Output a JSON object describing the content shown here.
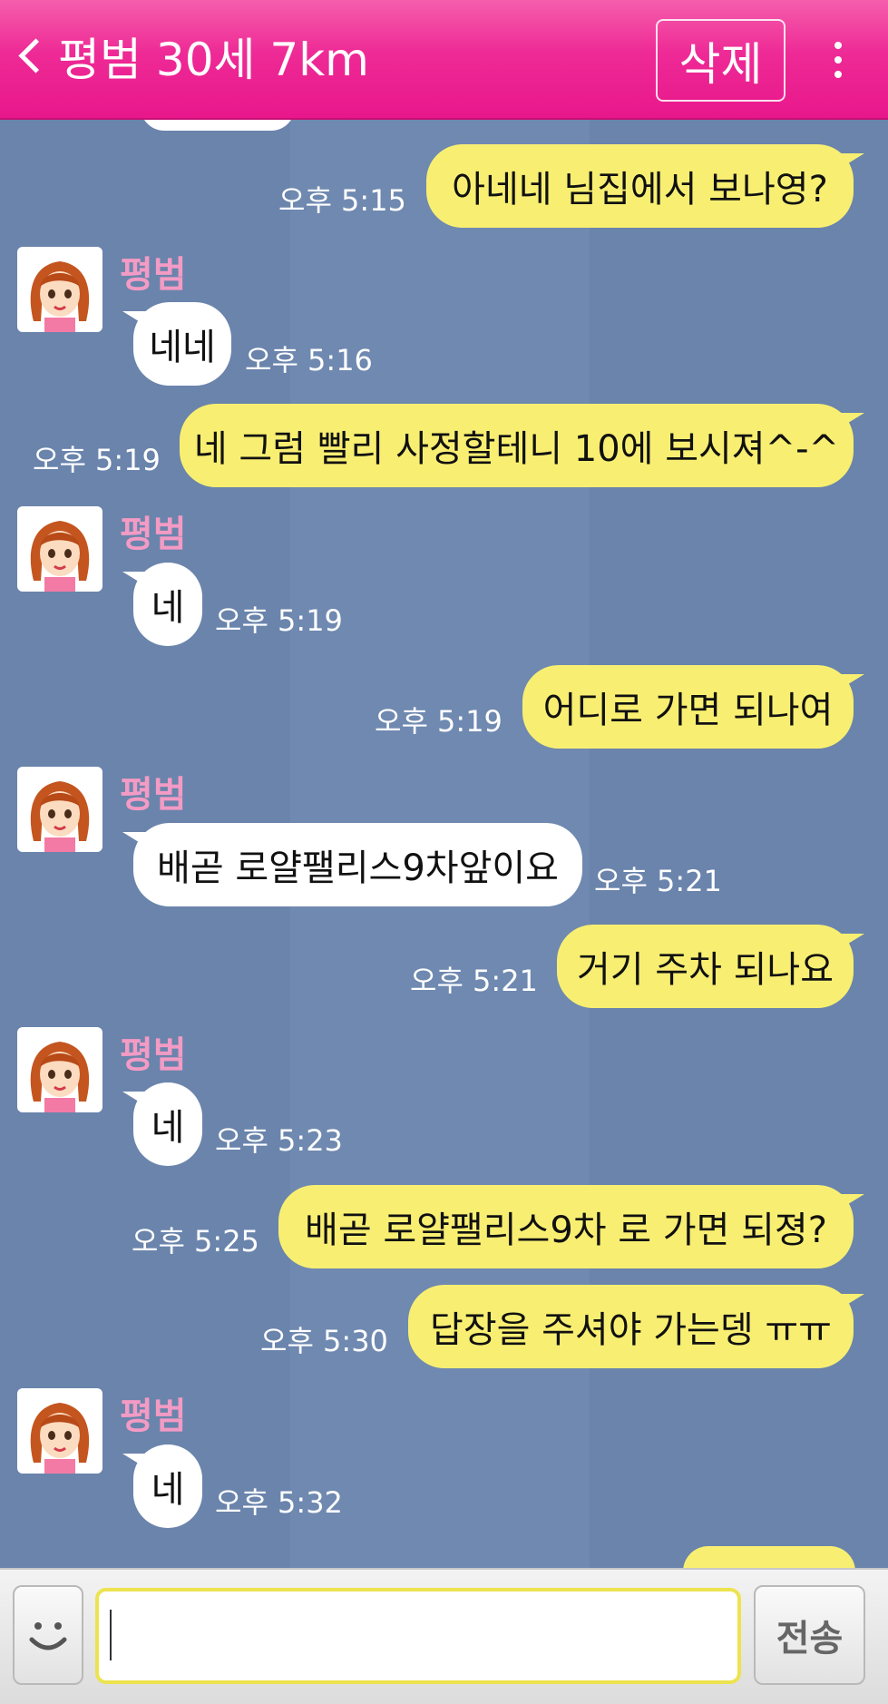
{
  "header": {
    "title": "평범 30세 7km",
    "delete_label": "삭제"
  },
  "messages": [
    {
      "from": "me",
      "text": "아네네 님집에서 보나영?",
      "time": "오후 5:15"
    },
    {
      "from": "other",
      "sender": "평범",
      "text": "네네",
      "time": "오후 5:16"
    },
    {
      "from": "me",
      "text": "네 그럼 빨리 사정할테니 10에 보시져^-^",
      "time": "오후 5:19"
    },
    {
      "from": "other",
      "sender": "평범",
      "text": "네",
      "time": "오후 5:19"
    },
    {
      "from": "me",
      "text": "어디로 가면 되나여",
      "time": "오후 5:19"
    },
    {
      "from": "other",
      "sender": "평범",
      "text": "배곧 로얄팰리스9차앞이요",
      "time": "오후 5:21"
    },
    {
      "from": "me",
      "text": "거기 주차 되나요",
      "time": "오후 5:21"
    },
    {
      "from": "other",
      "sender": "평범",
      "text": "네",
      "time": "오후 5:23"
    },
    {
      "from": "me",
      "text": "배곧 로얄팰리스9차 로 가면 되졍?",
      "time": "오후 5:25"
    },
    {
      "from": "me",
      "text": "답장을 주셔야 가는뎅 ㅠㅠ",
      "time": "오후 5:30"
    },
    {
      "from": "other",
      "sender": "평범",
      "text": "네",
      "time": "오후 5:32"
    }
  ],
  "input": {
    "value": "",
    "send_label": "전송"
  },
  "icons": {
    "back": "chevron-left-icon",
    "menu": "more-vertical-icon",
    "emoji": "smiley-icon",
    "avatar": "girl-avatar-icon"
  },
  "colors": {
    "header": "#ee2a96",
    "chat_background": "#6a84ac",
    "my_bubble": "#f8ef72",
    "their_bubble": "#ffffff",
    "sender_name": "#f39bc4",
    "input_border": "#ede34f"
  }
}
